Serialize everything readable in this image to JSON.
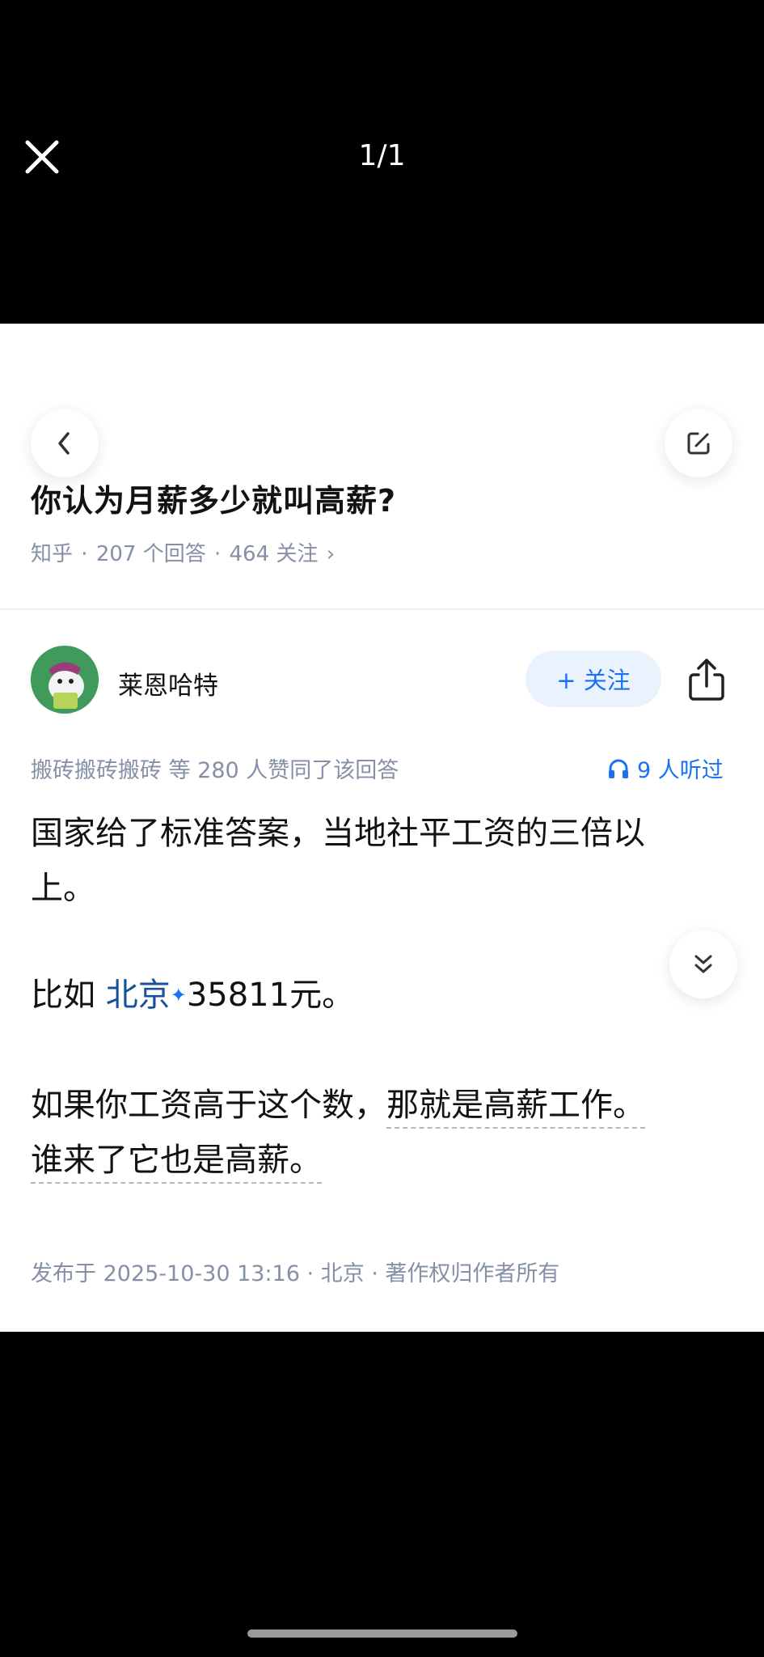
{
  "viewer": {
    "counter": "1/1"
  },
  "question": {
    "title": "你认为月薪多少就叫高薪?",
    "meta_source": "知乎",
    "meta_answers": "207 个回答",
    "meta_follows": "464 关注",
    "meta_sep": "·",
    "meta_chevron": "›"
  },
  "answer": {
    "author": "莱恩哈特",
    "follow_label": "+ 关注",
    "upvote_text": "搬砖搬砖搬砖 等 280 人赞同了该回答",
    "listen_text": "9 人听过",
    "para1_line1": "国家给了标准答案，当地社平工资的三倍以",
    "para1_line2": "上。",
    "para2_prefix": "比如 ",
    "para2_link": "北京",
    "para2_sparkle": "✦",
    "para2_suffix": "35811元。",
    "para3_line1_plain": "如果你工资高于这个数，",
    "para3_line1_dashed": "那就是高薪工作。",
    "para3_line2_dashed": "谁来了它也是高薪。",
    "pub_info": "发布于 2025-10-30 13:16 · 北京 · 著作权归作者所有"
  },
  "colors": {
    "accent": "#1772f6",
    "link": "#175199",
    "meta": "#8590a6",
    "text": "#121212"
  }
}
